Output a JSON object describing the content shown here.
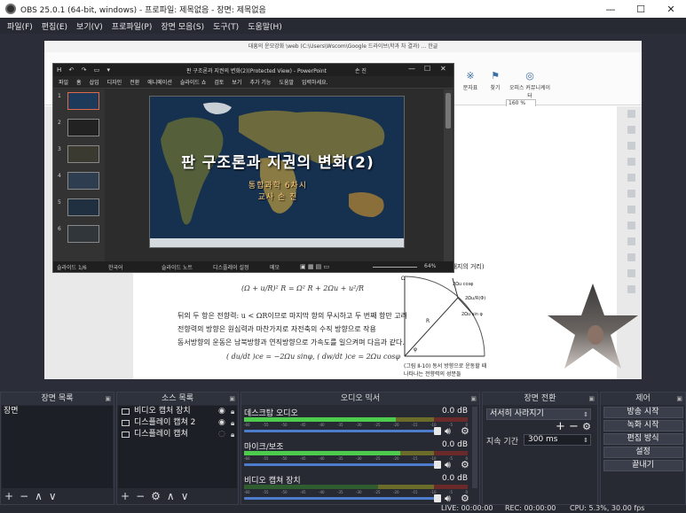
{
  "window": {
    "title": "OBS 25.0.1 (64-bit, windows) - 프로파일: 제목없음 - 장면: 제목없음",
    "minimize_glyph": "—",
    "maximize_glyph": "☐",
    "close_glyph": "✕"
  },
  "menu": [
    "파일(F)",
    "편집(E)",
    "보기(V)",
    "프로파일(P)",
    "장면 모음(S)",
    "도구(T)",
    "도움말(H)"
  ],
  "word_doc": {
    "title": "대흥의 운모강화 \\web (C:\\Users\\Wscom\\Google 드라이브\\학과 차 결과) ... 한글",
    "ribbon": [
      {
        "icon": "※",
        "label": "문자표"
      },
      {
        "icon": "⚑",
        "label": "찾기"
      },
      {
        "icon": "◎",
        "label": "오피스 커뮤니케이터"
      }
    ],
    "zoom": "160 %",
    "side_note": "초깨지의 거리)",
    "formula1": "(Ω + u/R)² R = Ω² R + 2Ωu + u²/R",
    "text_lines": [
      "뒤의 두 항은 전향력: u < ΩR이므로 마지막 항의 무시하고 두 번째 항만 고려",
      "전향력의 방향은 원심력과 마찬가지로 자전축의 수직 방향으로 작용",
      "동서방향의 운동은 남북방향과 연직방향으로 가속도를 일으켜며 다음과 같다."
    ],
    "formula2": "( du/dt )ce = −2Ωu sinφ,   ( dw/dt )ce = 2Ωu cosφ",
    "figure_caption_1": "(그림 Ⅱ-10)  동서 방향으로 운동할 때",
    "figure_caption_2": "나타나는 전향력의 성분들",
    "figure_labels": [
      "Ω",
      "2Ωu cosφ",
      "2Ωu/R(Φ)",
      "2Ωu sin φ",
      "φ",
      "R"
    ]
  },
  "ppt": {
    "title": "판 구조론과 지권의 변화(2)(Protected View) - PowerPoint",
    "user_label": "손 진",
    "quick_access": "H ↶ ↷ ▭ ▾",
    "tabs": [
      "파일",
      "홈",
      "삽입",
      "디자인",
      "전환",
      "애니메이션",
      "슬라이드 쇼",
      "검토",
      "보기",
      "추가 기능",
      "도움말",
      "입력하세요."
    ],
    "thumb_numbers": [
      "1",
      "2",
      "3",
      "4",
      "5",
      "6"
    ],
    "slide_title": "판  구조론과  지권의  변화(2)",
    "slide_sub1": "통합과학   6차시",
    "slide_sub2": "교사  손  진",
    "status_slide": "슬라이드 1/6",
    "status_lang": "한국어",
    "status_notes": "슬라이드 노트",
    "status_display": "디스플레이 설정",
    "status_comments": "메모",
    "status_zoom": "64%"
  },
  "docks": {
    "scenes": {
      "header": "장면 목록",
      "items": [
        "장면"
      ]
    },
    "sources": {
      "header": "소스 목록",
      "items": [
        {
          "name": "비디오 캡처 장치",
          "icon": "camera-icon"
        },
        {
          "name": "디스플레이 캡쳐 2",
          "icon": "monitor-icon"
        },
        {
          "name": "디스플레이 캡쳐",
          "icon": "monitor-icon"
        }
      ]
    },
    "mixer": {
      "header": "오디오 믹서",
      "channels": [
        {
          "name": "데스크탑 오디오",
          "db": "0.0 dB",
          "level": 0.68
        },
        {
          "name": "마이크/보조",
          "db": "0.0 dB",
          "level": 0.7
        },
        {
          "name": "비디오 캡쳐 장치",
          "db": "0.0 dB",
          "level": 0.0
        }
      ],
      "tick_labels": [
        "-60",
        "-55",
        "-50",
        "-45",
        "-40",
        "-35",
        "-30",
        "-25",
        "-20",
        "-15",
        "-10",
        "-5",
        "0"
      ]
    },
    "transitions": {
      "header": "장면 전환",
      "selected": "서서히 사라지기",
      "duration_label": "지속 기간",
      "duration_value": "300 ms"
    },
    "controls": {
      "header": "제어",
      "buttons": [
        "방송 시작",
        "녹화 시작",
        "편집 방식",
        "설정",
        "끝내기"
      ]
    }
  },
  "status": {
    "live": "LIVE: 00:00:00",
    "rec": "REC: 00:00:00",
    "cpu": "CPU: 5.3%, 30.00 fps"
  }
}
